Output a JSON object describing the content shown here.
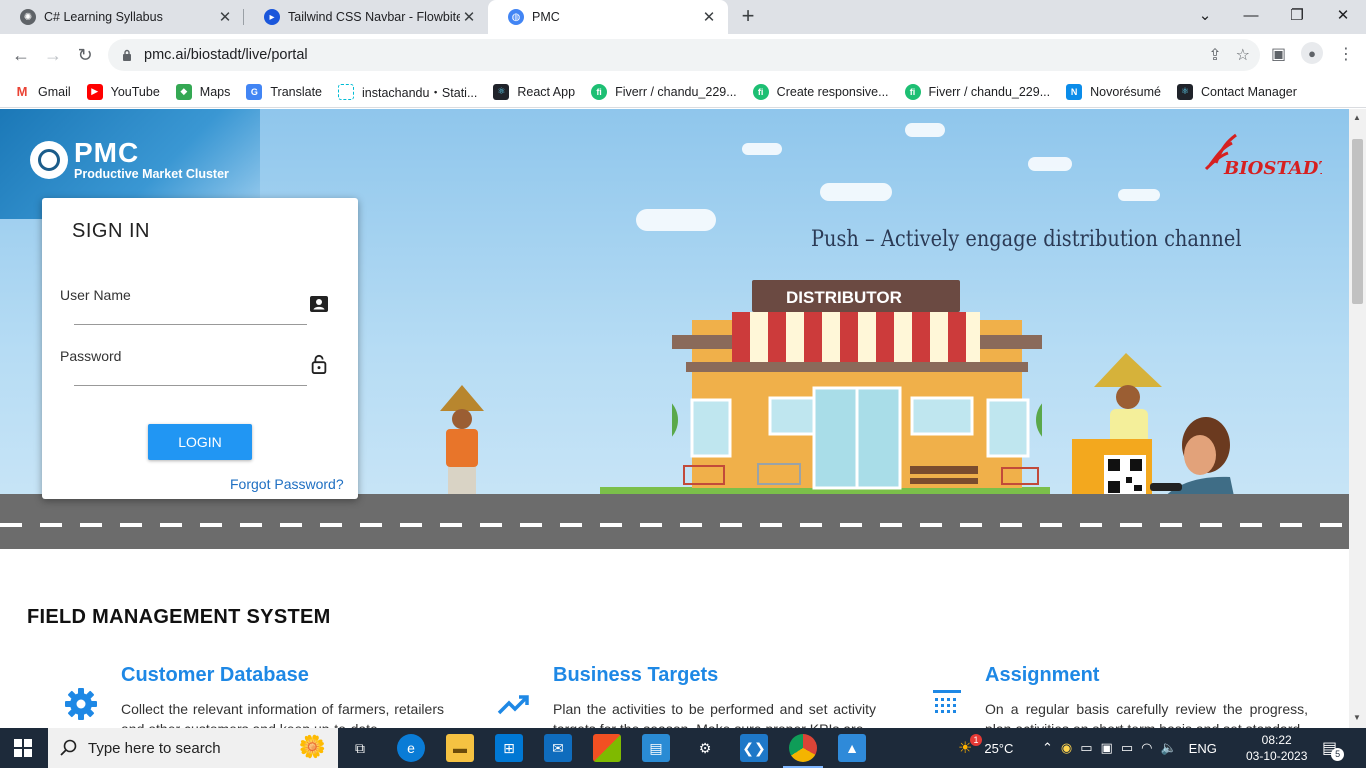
{
  "browser": {
    "tabs": [
      {
        "title": "C# Learning Syllabus",
        "icon_color": "#5f6368",
        "active": false
      },
      {
        "title": "Tailwind CSS Navbar - Flowbite",
        "icon_color": "#1a56db",
        "active": false
      },
      {
        "title": "PMC",
        "icon_color": "#4285f4",
        "active": true
      }
    ],
    "url": "pmc.ai/biostadt/live/portal",
    "bookmarks": [
      {
        "label": "Gmail",
        "icon": "gmail-icon",
        "color": "#ea4335"
      },
      {
        "label": "YouTube",
        "icon": "youtube-icon",
        "color": "#ff0000"
      },
      {
        "label": "Maps",
        "icon": "maps-icon",
        "color": "#34a853"
      },
      {
        "label": "Translate",
        "icon": "translate-icon",
        "color": "#4285f4"
      },
      {
        "label": "instachandu・Stati...",
        "icon": "page-icon",
        "color": "#00bcd4"
      },
      {
        "label": "React App",
        "icon": "react-icon",
        "color": "#20232a"
      },
      {
        "label": "Fiverr / chandu_229...",
        "icon": "fiverr-icon",
        "color": "#1dbf73"
      },
      {
        "label": "Create responsive...",
        "icon": "fiverr-icon",
        "color": "#1dbf73"
      },
      {
        "label": "Fiverr / chandu_229...",
        "icon": "fiverr-icon",
        "color": "#1dbf73"
      },
      {
        "label": "Novorésumé",
        "icon": "novoresume-icon",
        "color": "#0b8ce9"
      },
      {
        "label": "Contact Manager",
        "icon": "react-icon",
        "color": "#20232a"
      }
    ]
  },
  "hero": {
    "logo_title": "PMC",
    "logo_subtitle": "Productive Market Cluster",
    "brand": "BIOSTADT",
    "tagline": "Push – Actively engage distribution channel",
    "shop_sign": "DISTRIBUTOR"
  },
  "signin": {
    "heading": "SIGN IN",
    "username_label": "User Name",
    "password_label": "Password",
    "login_label": "LOGIN",
    "forgot_label": "Forgot Password?"
  },
  "features": {
    "section_title": "FIELD MANAGEMENT SYSTEM",
    "items": [
      {
        "title": "Customer Database",
        "desc": "Collect the relevant information of farmers, retailers and other customers and keep up-to-date",
        "icon": "gear-icon"
      },
      {
        "title": "Business Targets",
        "desc": "Plan the activities to be performed and set activity targets for the season. Make sure proper KPIs are",
        "icon": "trending-up-icon"
      },
      {
        "title": "Assignment",
        "desc": "On a regular basis carefully review the progress, plan activities on short term basis and set standard",
        "icon": "calendar-grid-icon"
      }
    ]
  },
  "taskbar": {
    "search_placeholder": "Type here to search",
    "weather": "25°C",
    "weather_badge": "1",
    "language": "ENG",
    "time": "08:22",
    "date": "03-10-2023",
    "notification_count": "5"
  },
  "colors": {
    "accent": "#2196f3",
    "feature_title": "#1e88e5",
    "taskbar": "#1d2a3a"
  }
}
